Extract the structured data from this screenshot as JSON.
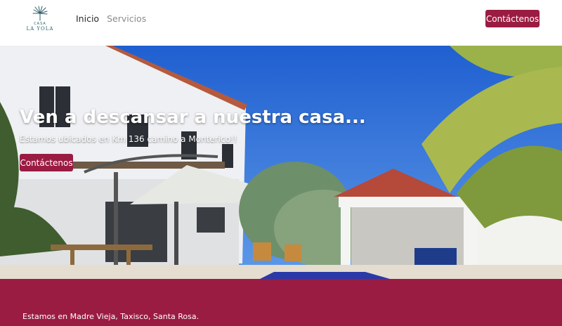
{
  "brand": {
    "logo_top": "CASA",
    "logo_bottom": "LA YOLA",
    "accent_color": "#9a1c43"
  },
  "nav": {
    "items": [
      {
        "label": "Inicio",
        "active": true
      },
      {
        "label": "Servicios",
        "active": false
      }
    ],
    "cta_label": "Contáctenos"
  },
  "hero": {
    "title": "Ven a descansar a nuestra casa...",
    "subtitle": "Estamos ubicados en Km 136 camino a Monterico!!",
    "cta_label": "Contáctenos",
    "image": "house-with-pool-and-palm-trees"
  },
  "footer": {
    "text": "Estamos en Madre Vieja, Taxisco, Santa Rosa."
  }
}
